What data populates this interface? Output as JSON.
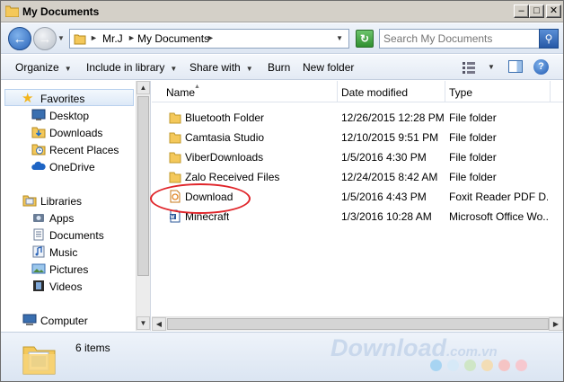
{
  "window": {
    "title": "My Documents"
  },
  "address": {
    "crumbs": [
      "Mr.J",
      "My Documents"
    ]
  },
  "search": {
    "placeholder": "Search My Documents"
  },
  "toolbar": {
    "organize": "Organize",
    "include_in_library": "Include in library",
    "share_with": "Share with",
    "burn": "Burn",
    "new_folder": "New folder"
  },
  "nav": {
    "favorites": {
      "label": "Favorites",
      "items": [
        "Desktop",
        "Downloads",
        "Recent Places",
        "OneDrive"
      ]
    },
    "libraries": {
      "label": "Libraries",
      "items": [
        "Apps",
        "Documents",
        "Music",
        "Pictures",
        "Videos"
      ]
    },
    "computer": "Computer"
  },
  "columns": {
    "name": "Name",
    "date": "Date modified",
    "type": "Type"
  },
  "files": [
    {
      "name": "Bluetooth Folder",
      "date": "12/26/2015 12:28 PM",
      "type": "File folder",
      "icon": "folder-icon"
    },
    {
      "name": "Camtasia Studio",
      "date": "12/10/2015 9:51 PM",
      "type": "File folder",
      "icon": "folder-icon"
    },
    {
      "name": "ViberDownloads",
      "date": "1/5/2016 4:30 PM",
      "type": "File folder",
      "icon": "folder-icon"
    },
    {
      "name": "Zalo Received Files",
      "date": "12/24/2015 8:42 AM",
      "type": "File folder",
      "icon": "folder-icon"
    },
    {
      "name": "Download",
      "date": "1/5/2016 4:43 PM",
      "type": "Foxit Reader PDF D...",
      "icon": "pdf-icon"
    },
    {
      "name": "Minecraft",
      "date": "1/3/2016 10:28 AM",
      "type": "Microsoft Office Wo...",
      "icon": "word-doc-icon"
    }
  ],
  "status": {
    "count": "6 items"
  },
  "watermark": {
    "brand": "Download",
    "suffix": ".com.vn"
  },
  "colors": {
    "accent": "#2b64b8",
    "highlight_ellipse": "#e0252a",
    "folder": "#f4c85a",
    "watermark_dots": [
      "#a7d4f2",
      "#d6e9f7",
      "#cfe6c6",
      "#f3ddb5",
      "#f5c4c4",
      "#f6c8cf"
    ]
  }
}
